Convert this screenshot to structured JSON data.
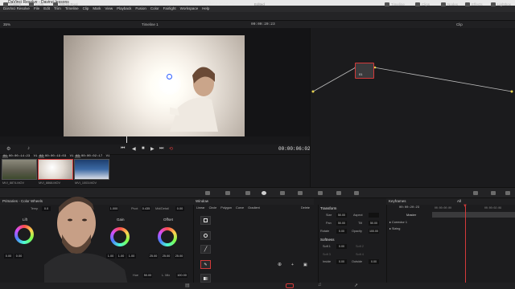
{
  "window": {
    "title": "DaVinci Resolve - Davinci lessons"
  },
  "menu": [
    "DaVinci Resolve",
    "File",
    "Edit",
    "Trim",
    "Timeline",
    "Clip",
    "Mark",
    "View",
    "Playback",
    "Fusion",
    "Color",
    "Fairlight",
    "Workspace",
    "Help"
  ],
  "toolbar": {
    "gallery": "Gallery",
    "luts": "LUTs",
    "media_pool": "Media Pool",
    "project_title": "Davinci lessons",
    "project_status": "Edited",
    "timeline": "Timeline",
    "clips": "Clips",
    "nodes": "Nodes",
    "effects": "Effects",
    "lightbox": "Lightbox"
  },
  "viewer": {
    "zoom": "35%",
    "timeline_name": "Timeline 1",
    "header_tc": "00:00:20:23",
    "timecode": "00:00:06:02"
  },
  "clips": [
    {
      "num": "01",
      "tc": "00:00:14:23",
      "track": "V1",
      "name": "MVI_8874.MOV"
    },
    {
      "num": "02",
      "tc": "00:00:19:03",
      "track": "V1",
      "name": "MVI_8868.MOV"
    },
    {
      "num": "03",
      "tc": "00:00:02:17",
      "track": "V1",
      "name": "MVI_1003.MOV"
    }
  ],
  "node_editor": {
    "mode": "Clip",
    "node_label": "01"
  },
  "primaries": {
    "title": "Primaries - Color Wheels",
    "temp_label": "Temp",
    "temp": "0.0",
    "tint_label": "Tint",
    "tint": "0.00",
    "contrast_val": "1.000",
    "pivot_label": "Pivot",
    "pivot": "0.435",
    "middetail_label": "Mid/Detail",
    "middetail": "0.00",
    "lift_label": "Lift",
    "gain_label": "Gain",
    "offset_label": "Offset",
    "lift_vals": [
      "0.00",
      "0.00",
      "0.00"
    ],
    "gamma_vals": [
      "0.00",
      "0.00",
      "0.00"
    ],
    "gain_vals": [
      "1.00",
      "1.00",
      "1.00"
    ],
    "offset_vals": [
      "25.00",
      "25.00",
      "25.00"
    ],
    "hue_label": "Hue",
    "hue": "50.00",
    "lummix_label": "L. Mix",
    "lummix": "100.00"
  },
  "window_panel": {
    "title": "Window",
    "tools": [
      "Linear",
      "Circle",
      "Polygon",
      "Curve",
      "Gradient"
    ],
    "delete": "Delete"
  },
  "transform": {
    "title": "Transform",
    "size_label": "Size",
    "size": "50.00",
    "aspect_label": "Aspect",
    "aspect": "",
    "pan_label": "Pan",
    "pan": "50.00",
    "tilt_label": "Tilt",
    "tilt": "50.00",
    "rotate_label": "Rotate",
    "rotate": "0.00",
    "opacity_label": "Opacity",
    "opacity": "100.00",
    "softness_title": "Softness",
    "soft1_label": "Soft 1",
    "soft1": "0.00",
    "soft2_label": "Soft 2",
    "soft3_label": "Soft 3",
    "soft4_label": "Soft 4",
    "inside_label": "Inside",
    "inside": "0.00",
    "outside_label": "Outside",
    "outside": "0.00"
  },
  "keyframes": {
    "title": "Keyframes",
    "filter": "All",
    "tc": "00:00:20:23",
    "ruler_start": "00:00:00:00",
    "ruler_end": "00:00:02:08",
    "master": "Master",
    "corrector": "Corrector 1",
    "sizing": "Sizing"
  },
  "colors": {
    "accent_red": "#d43a3a",
    "node_line_cyan": "#5fd0ff",
    "node_line_yellow": "#e6d24d"
  }
}
